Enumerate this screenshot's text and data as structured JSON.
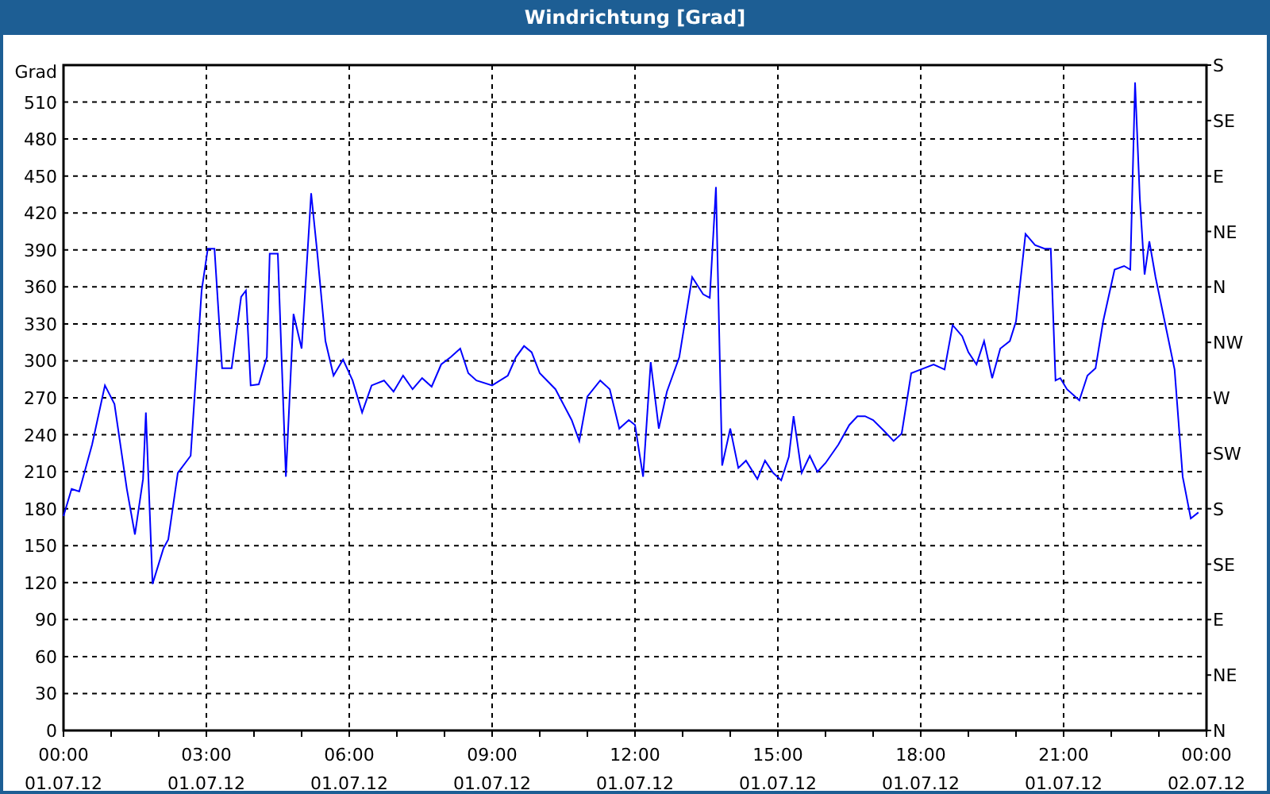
{
  "window": {
    "title": "Windrichtung [Grad]"
  },
  "chart": {
    "x_date_labels": [
      "01.07.12",
      "01.07.12",
      "01.07.12",
      "01.07.12",
      "01.07.12",
      "01.07.12",
      "01.07.12",
      "01.07.12",
      "02.07.12"
    ],
    "right_axis_labels": [
      "S",
      "SE",
      "E",
      "NE",
      "N",
      "NW",
      "W",
      "SW",
      "S",
      "SE",
      "E",
      "NE",
      "N"
    ],
    "chart_data": {
      "type": "line",
      "grid": true,
      "ylabel": "Grad",
      "xlim": [
        0,
        24
      ],
      "ylim": [
        0,
        540
      ],
      "yticks": [
        0,
        30,
        60,
        90,
        120,
        150,
        180,
        210,
        240,
        270,
        300,
        330,
        360,
        390,
        420,
        450,
        480,
        510
      ],
      "xticks": [
        {
          "value": 0,
          "label": "00:00"
        },
        {
          "value": 3,
          "label": "03:00"
        },
        {
          "value": 6,
          "label": "06:00"
        },
        {
          "value": 9,
          "label": "09:00"
        },
        {
          "value": 12,
          "label": "12:00"
        },
        {
          "value": 15,
          "label": "15:00"
        },
        {
          "value": 18,
          "label": "18:00"
        },
        {
          "value": 21,
          "label": "21:00"
        },
        {
          "value": 24,
          "label": "00:00"
        }
      ],
      "x": [
        0,
        0.17,
        0.33,
        0.6,
        0.87,
        1.07,
        1.33,
        1.5,
        1.67,
        1.73,
        1.87,
        2.1,
        2.2,
        2.4,
        2.67,
        2.9,
        3.03,
        3.17,
        3.33,
        3.53,
        3.73,
        3.83,
        3.93,
        4.1,
        4.27,
        4.33,
        4.5,
        4.67,
        4.83,
        5.0,
        5.2,
        5.33,
        5.5,
        5.67,
        5.87,
        6.07,
        6.27,
        6.47,
        6.73,
        6.93,
        7.13,
        7.33,
        7.53,
        7.73,
        7.93,
        8.13,
        8.33,
        8.5,
        8.67,
        9.0,
        9.33,
        9.5,
        9.67,
        9.83,
        10.0,
        10.33,
        10.67,
        10.83,
        11.0,
        11.27,
        11.47,
        11.67,
        11.87,
        12.0,
        12.17,
        12.33,
        12.5,
        12.67,
        12.93,
        13.2,
        13.43,
        13.57,
        13.7,
        13.83,
        14.0,
        14.17,
        14.33,
        14.57,
        14.73,
        14.9,
        15.07,
        15.23,
        15.33,
        15.5,
        15.67,
        15.83,
        16.0,
        16.27,
        16.5,
        16.67,
        16.83,
        17.0,
        17.23,
        17.43,
        17.6,
        17.8,
        18.0,
        18.27,
        18.5,
        18.67,
        18.87,
        19.0,
        19.17,
        19.33,
        19.5,
        19.67,
        19.87,
        20.0,
        20.2,
        20.4,
        20.6,
        20.73,
        20.83,
        20.93,
        21.07,
        21.33,
        21.5,
        21.67,
        21.83,
        22.07,
        22.27,
        22.4,
        22.5,
        22.6,
        22.7,
        22.8,
        22.93,
        23.17,
        23.33,
        23.5,
        23.67,
        23.83
      ],
      "series": [
        {
          "color": "#0000ff",
          "values": [
            174,
            196,
            194,
            232,
            280,
            265,
            196,
            159,
            204,
            258,
            119,
            148,
            155,
            209,
            223,
            357,
            391,
            391,
            294,
            294,
            352,
            357,
            280,
            281,
            303,
            387,
            387,
            206,
            338,
            310,
            436,
            387,
            316,
            288,
            301,
            284,
            258,
            280,
            284,
            275,
            288,
            277,
            286,
            279,
            297,
            303,
            310,
            290,
            284,
            280,
            288,
            303,
            312,
            307,
            290,
            277,
            252,
            235,
            271,
            284,
            277,
            245,
            252,
            248,
            206,
            299,
            245,
            275,
            303,
            368,
            354,
            351,
            441,
            215,
            245,
            213,
            219,
            204,
            219,
            209,
            203,
            222,
            255,
            209,
            223,
            210,
            217,
            232,
            248,
            255,
            255,
            252,
            243,
            235,
            241,
            290,
            293,
            297,
            293,
            329,
            320,
            307,
            297,
            316,
            286,
            310,
            316,
            332,
            403,
            394,
            391,
            391,
            284,
            286,
            277,
            268,
            288,
            294,
            332,
            374,
            377,
            374,
            526,
            432,
            370,
            397,
            368,
            323,
            293,
            206,
            172,
            177
          ]
        }
      ]
    }
  }
}
